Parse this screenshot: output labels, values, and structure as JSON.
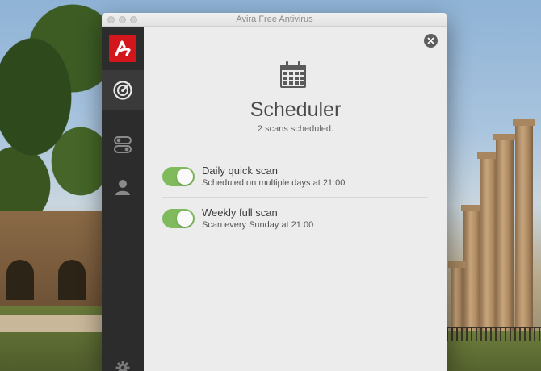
{
  "window": {
    "title": "Avira Free Antivirus"
  },
  "sidebar": {
    "items": [
      {
        "icon": "avira-logo-icon",
        "color": "#d3161c"
      },
      {
        "icon": "radar-scan-icon",
        "active": true
      },
      {
        "icon": "toggles-icon"
      },
      {
        "icon": "user-icon"
      },
      {
        "icon": "gear-icon"
      }
    ]
  },
  "scheduler": {
    "icon": "calendar-icon",
    "title": "Scheduler",
    "subtitle": "2 scans scheduled.",
    "items": [
      {
        "title": "Daily quick scan",
        "detail": "Scheduled on multiple days at 21:00",
        "enabled": true
      },
      {
        "title": "Weekly full scan",
        "detail": "Scan every Sunday at 21:00",
        "enabled": true
      }
    ]
  },
  "colors": {
    "accent_green": "#7fba5c",
    "brand_red": "#d3161c",
    "sidebar_bg": "#2c2c2c"
  }
}
